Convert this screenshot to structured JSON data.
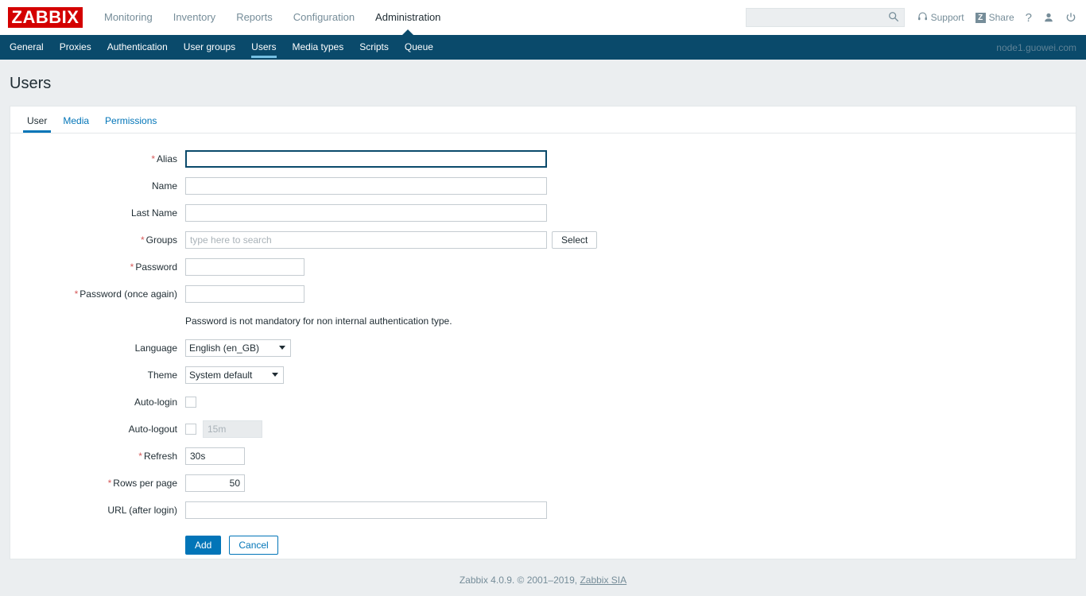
{
  "header": {
    "logo_text": "ZABBIX",
    "nav": [
      {
        "label": "Monitoring",
        "selected": false
      },
      {
        "label": "Inventory",
        "selected": false
      },
      {
        "label": "Reports",
        "selected": false
      },
      {
        "label": "Configuration",
        "selected": false
      },
      {
        "label": "Administration",
        "selected": true
      }
    ],
    "search_placeholder": "",
    "search_value": "",
    "support_label": "Support",
    "share_label": "Share",
    "share_badge": "Z",
    "help_label": "?",
    "icons": {
      "search": "search-icon",
      "support": "headphones-icon",
      "share": "share-icon",
      "help": "question-mark-icon",
      "user": "user-icon",
      "signout": "power-icon"
    }
  },
  "subnav": {
    "items": [
      {
        "label": "General",
        "selected": false
      },
      {
        "label": "Proxies",
        "selected": false
      },
      {
        "label": "Authentication",
        "selected": false
      },
      {
        "label": "User groups",
        "selected": false
      },
      {
        "label": "Users",
        "selected": true
      },
      {
        "label": "Media types",
        "selected": false
      },
      {
        "label": "Scripts",
        "selected": false
      },
      {
        "label": "Queue",
        "selected": false
      }
    ],
    "node_name": "node1.guowei.com"
  },
  "page": {
    "title": "Users"
  },
  "tabs": [
    {
      "label": "User",
      "selected": true
    },
    {
      "label": "Media",
      "selected": false
    },
    {
      "label": "Permissions",
      "selected": false
    }
  ],
  "form": {
    "alias": {
      "label": "Alias",
      "required": true,
      "value": "",
      "placeholder": ""
    },
    "name": {
      "label": "Name",
      "required": false,
      "value": "",
      "placeholder": ""
    },
    "last_name": {
      "label": "Last Name",
      "required": false,
      "value": "",
      "placeholder": ""
    },
    "groups": {
      "label": "Groups",
      "required": true,
      "value": "",
      "placeholder": "type here to search",
      "select_button": "Select"
    },
    "password": {
      "label": "Password",
      "required": true,
      "value": ""
    },
    "password_again": {
      "label": "Password (once again)",
      "required": true,
      "value": ""
    },
    "password_hint": "Password is not mandatory for non internal authentication type.",
    "language": {
      "label": "Language",
      "required": false,
      "value": "English (en_GB)",
      "options": [
        "English (en_GB)"
      ]
    },
    "theme": {
      "label": "Theme",
      "required": false,
      "value": "System default",
      "options": [
        "System default"
      ]
    },
    "auto_login": {
      "label": "Auto-login",
      "required": false,
      "checked": false
    },
    "auto_logout": {
      "label": "Auto-logout",
      "required": false,
      "checked": false,
      "value": "15m",
      "disabled": true
    },
    "refresh": {
      "label": "Refresh",
      "required": true,
      "value": "30s"
    },
    "rows_per_page": {
      "label": "Rows per page",
      "required": true,
      "value": "50"
    },
    "url_after_login": {
      "label": "URL (after login)",
      "required": false,
      "value": "",
      "placeholder": ""
    },
    "buttons": {
      "add": "Add",
      "cancel": "Cancel"
    }
  },
  "footer": {
    "text": "Zabbix 4.0.9. © 2001–2019, ",
    "link": "Zabbix SIA"
  },
  "colors": {
    "brand_red": "#d40000",
    "nav_dark": "#0a4a6b",
    "accent_blue": "#0275b8",
    "active_underline": "#76c0e3",
    "required_red": "#d65b5b",
    "page_bg": "#ebeef0"
  }
}
